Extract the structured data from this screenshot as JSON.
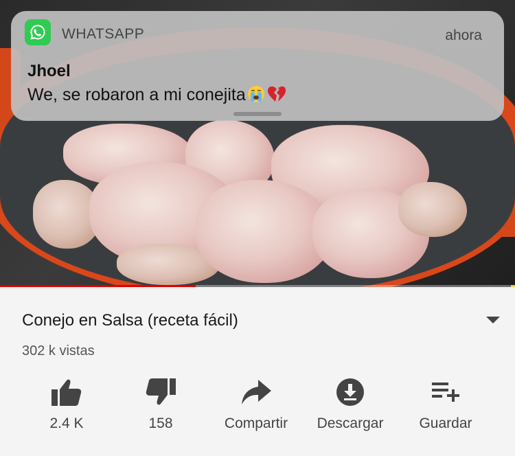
{
  "notification": {
    "app_name": "WHATSAPP",
    "time": "ahora",
    "sender": "Jhoel",
    "message": "We, se robaron a mi conejita",
    "emojis": [
      "crying-face",
      "broken-heart"
    ]
  },
  "video": {
    "progress": 0.38
  },
  "info": {
    "title": "Conejo en Salsa (receta fácil)",
    "views": "302 k vistas"
  },
  "actions": [
    {
      "icon": "thumbs-up-icon",
      "label": "2.4 K"
    },
    {
      "icon": "thumbs-down-icon",
      "label": "158"
    },
    {
      "icon": "share-icon",
      "label": "Compartir"
    },
    {
      "icon": "download-icon",
      "label": "Descargar"
    },
    {
      "icon": "playlist-add-icon",
      "label": "Guardar"
    }
  ],
  "colors": {
    "accent_red": "#e00000",
    "whatsapp_green": "#2fcb52"
  }
}
